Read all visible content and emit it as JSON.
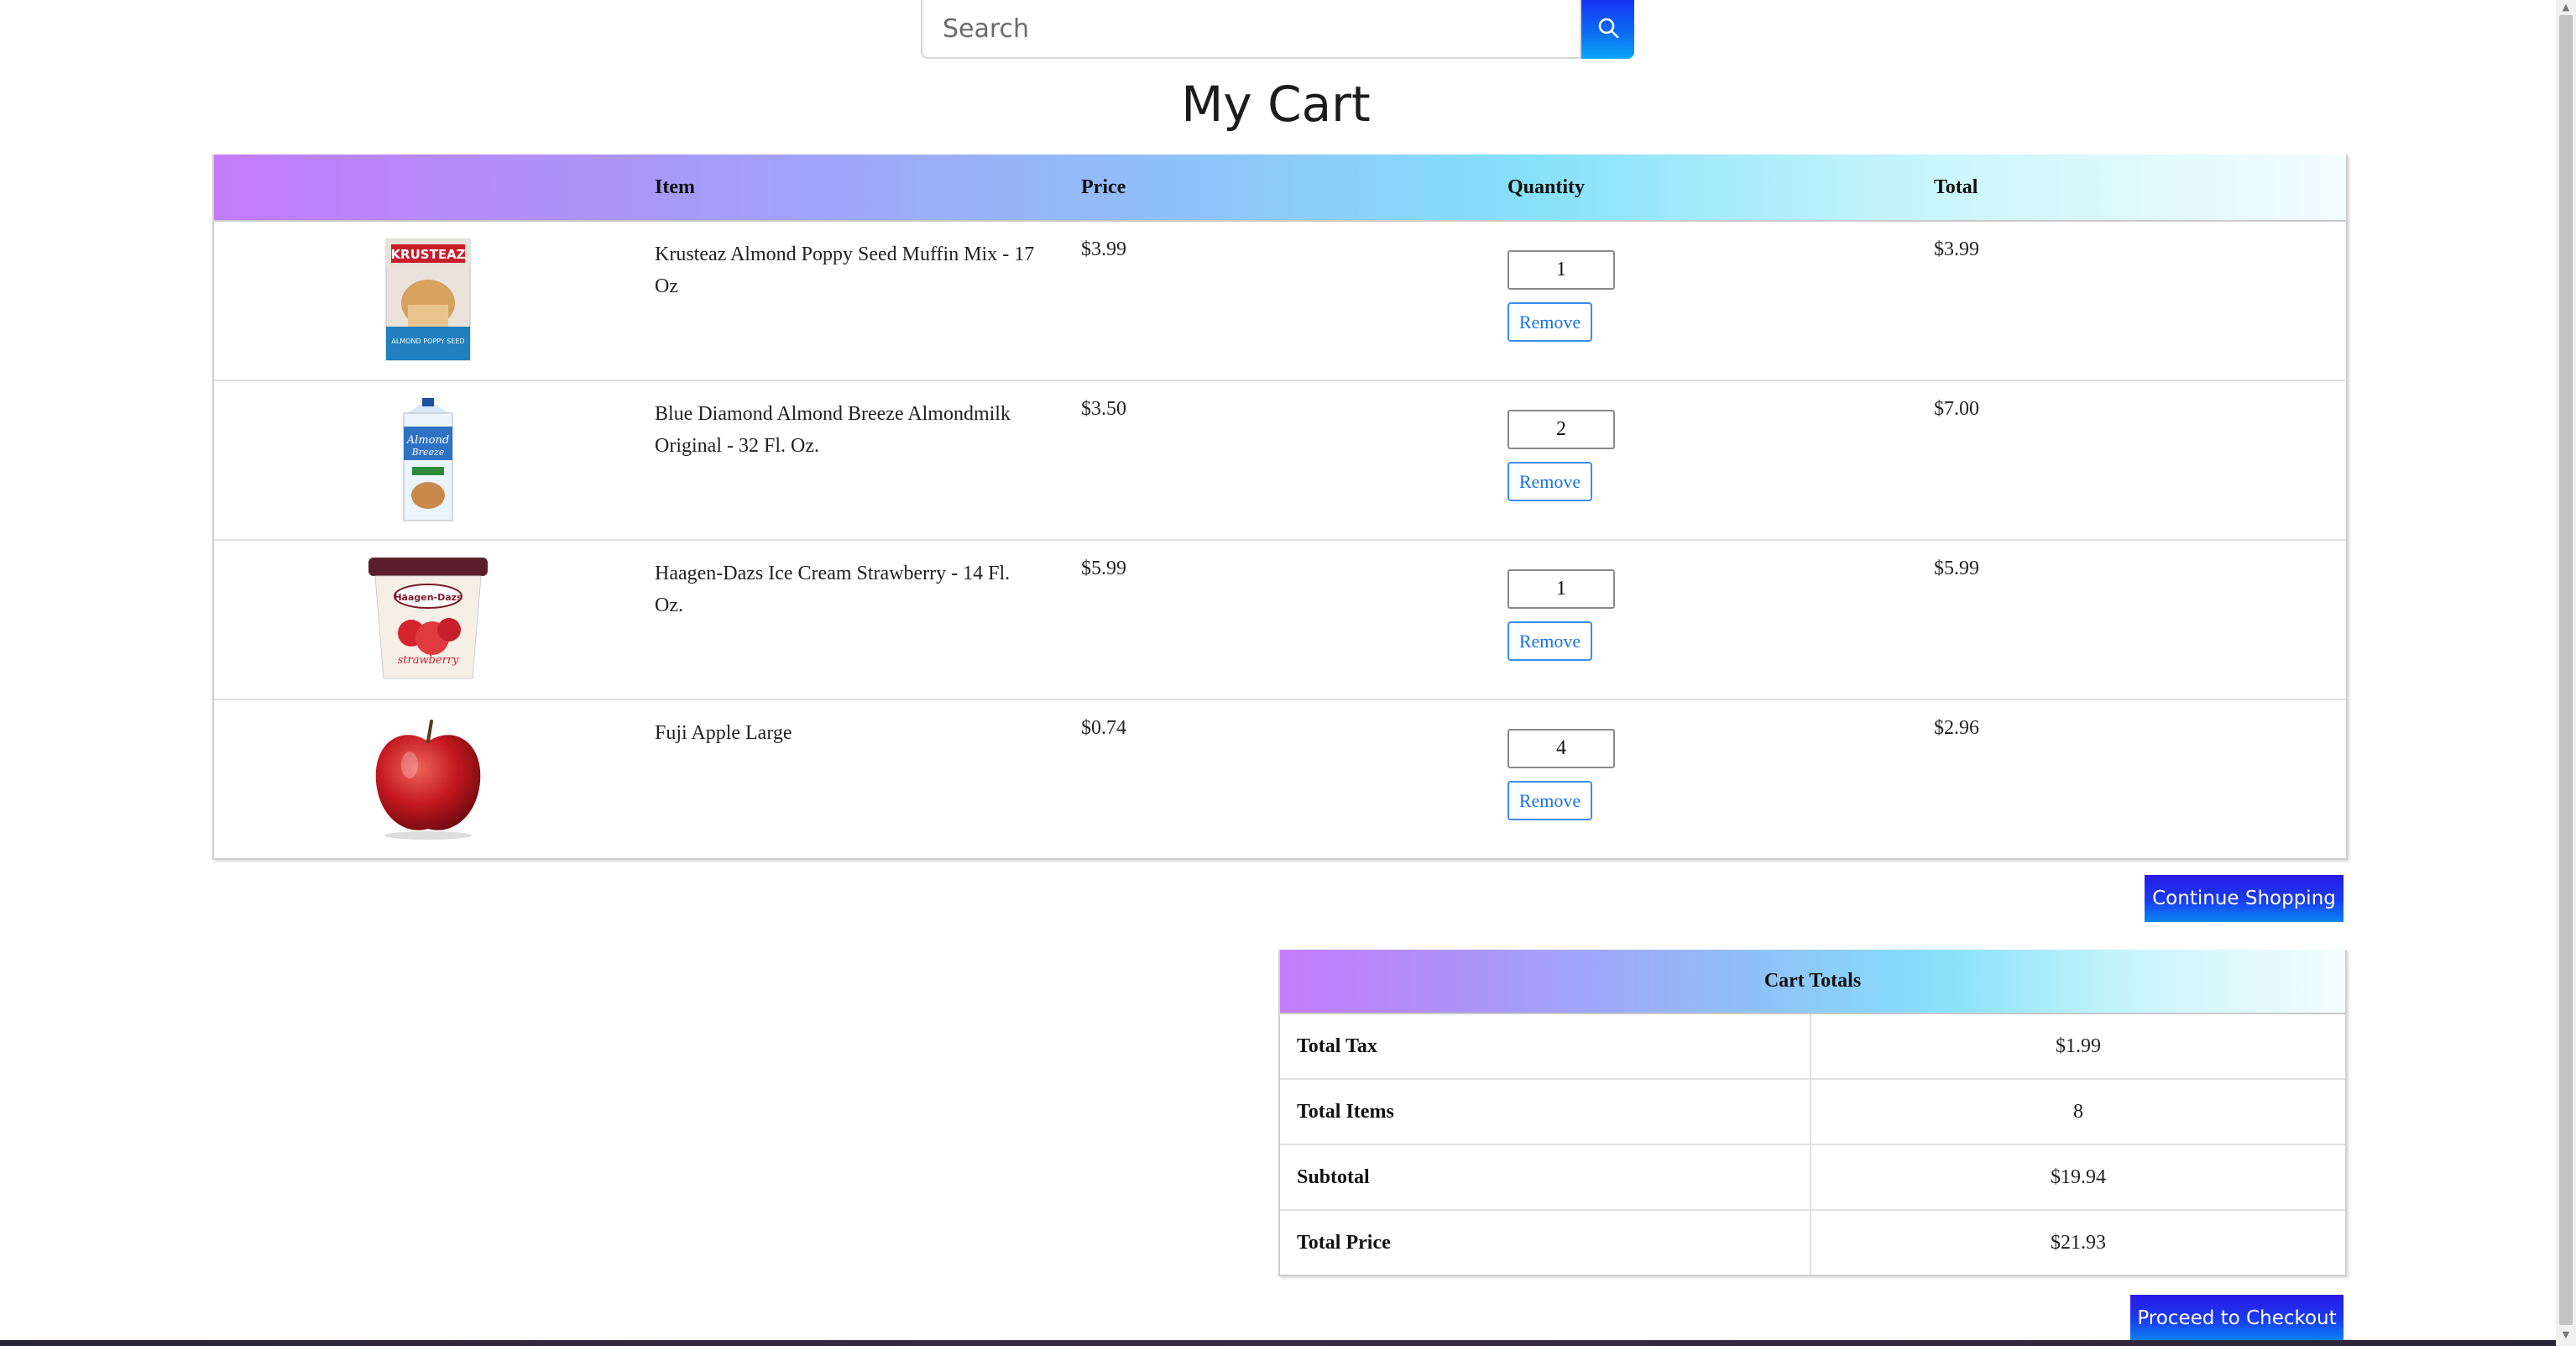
{
  "search": {
    "placeholder": "Search",
    "button_icon": "search-icon"
  },
  "page": {
    "title": "My Cart"
  },
  "cart_table": {
    "headers": {
      "item": "Item",
      "price": "Price",
      "quantity": "Quantity",
      "total": "Total"
    },
    "items": [
      {
        "image": "muffin-mix-box",
        "name": "Krusteaz Almond Poppy Seed Muffin Mix - 17 Oz",
        "price": "$3.99",
        "quantity": "1",
        "remove_label": "Remove",
        "total": "$3.99"
      },
      {
        "image": "almond-milk-carton",
        "name": "Blue Diamond Almond Breeze Almondmilk Original - 32 Fl. Oz.",
        "price": "$3.50",
        "quantity": "2",
        "remove_label": "Remove",
        "total": "$7.00"
      },
      {
        "image": "ice-cream-pint",
        "name": "Haagen-Dazs Ice Cream Strawberry - 14 Fl. Oz.",
        "price": "$5.99",
        "quantity": "1",
        "remove_label": "Remove",
        "total": "$5.99"
      },
      {
        "image": "red-apple",
        "name": "Fuji Apple Large",
        "price": "$0.74",
        "quantity": "4",
        "remove_label": "Remove",
        "total": "$2.96"
      }
    ]
  },
  "buttons": {
    "continue_shopping": "Continue Shopping",
    "checkout": "Proceed to Checkout"
  },
  "totals": {
    "title": "Cart Totals",
    "rows": [
      {
        "label": "Total Tax",
        "value": "$1.99"
      },
      {
        "label": "Total Items",
        "value": "8"
      },
      {
        "label": "Subtotal",
        "value": "$19.94"
      },
      {
        "label": "Total Price",
        "value": "$21.93"
      }
    ]
  },
  "colors": {
    "button_gradient_start": "#2a19e8",
    "button_gradient_end": "#0a87f3",
    "header_gradient_start": "#c37bf9",
    "header_gradient_end": "#f4fdfd",
    "remove_border": "#3a8df0"
  }
}
